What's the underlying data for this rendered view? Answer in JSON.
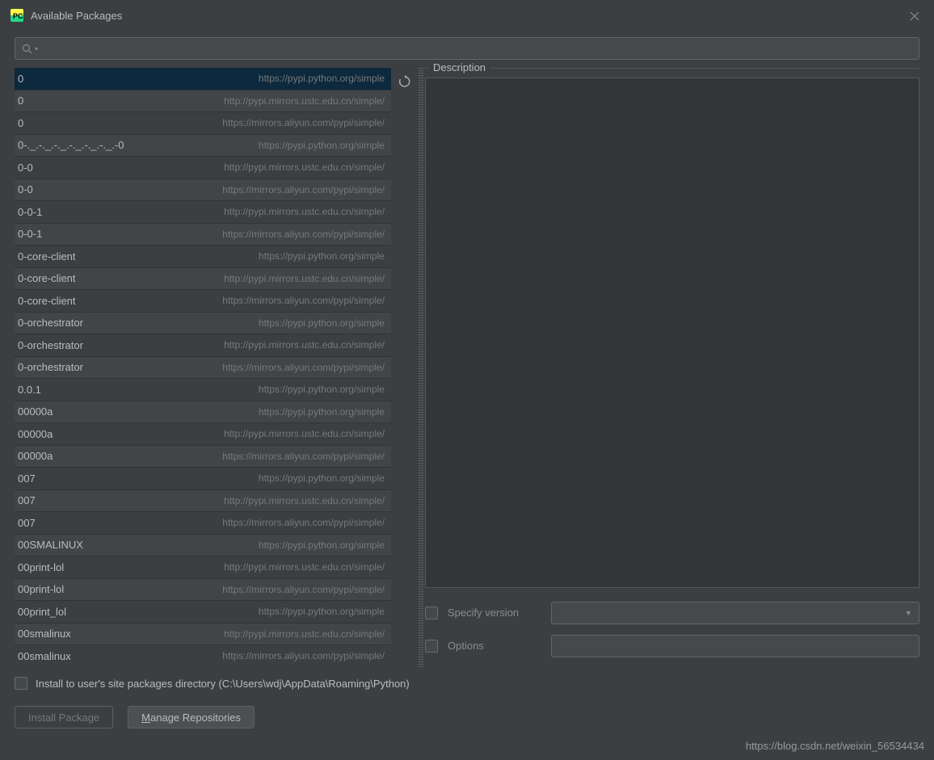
{
  "window": {
    "title": "Available Packages"
  },
  "packages": [
    {
      "name": "0",
      "source": "https://pypi.python.org/simple",
      "selected": true
    },
    {
      "name": "0",
      "source": "http://pypi.mirrors.ustc.edu.cn/simple/"
    },
    {
      "name": "0",
      "source": "https://mirrors.aliyun.com/pypi/simple/"
    },
    {
      "name": "0-._.-._.-._.-._.-._.-._.-0",
      "source": "https://pypi.python.org/simple"
    },
    {
      "name": "0-0",
      "source": "http://pypi.mirrors.ustc.edu.cn/simple/"
    },
    {
      "name": "0-0",
      "source": "https://mirrors.aliyun.com/pypi/simple/"
    },
    {
      "name": "0-0-1",
      "source": "http://pypi.mirrors.ustc.edu.cn/simple/"
    },
    {
      "name": "0-0-1",
      "source": "https://mirrors.aliyun.com/pypi/simple/"
    },
    {
      "name": "0-core-client",
      "source": "https://pypi.python.org/simple"
    },
    {
      "name": "0-core-client",
      "source": "http://pypi.mirrors.ustc.edu.cn/simple/"
    },
    {
      "name": "0-core-client",
      "source": "https://mirrors.aliyun.com/pypi/simple/"
    },
    {
      "name": "0-orchestrator",
      "source": "https://pypi.python.org/simple"
    },
    {
      "name": "0-orchestrator",
      "source": "http://pypi.mirrors.ustc.edu.cn/simple/"
    },
    {
      "name": "0-orchestrator",
      "source": "https://mirrors.aliyun.com/pypi/simple/"
    },
    {
      "name": "0.0.1",
      "source": "https://pypi.python.org/simple"
    },
    {
      "name": "00000a",
      "source": "https://pypi.python.org/simple"
    },
    {
      "name": "00000a",
      "source": "http://pypi.mirrors.ustc.edu.cn/simple/"
    },
    {
      "name": "00000a",
      "source": "https://mirrors.aliyun.com/pypi/simple/"
    },
    {
      "name": "007",
      "source": "https://pypi.python.org/simple"
    },
    {
      "name": "007",
      "source": "http://pypi.mirrors.ustc.edu.cn/simple/"
    },
    {
      "name": "007",
      "source": "https://mirrors.aliyun.com/pypi/simple/"
    },
    {
      "name": "00SMALINUX",
      "source": "https://pypi.python.org/simple"
    },
    {
      "name": "00print-lol",
      "source": "http://pypi.mirrors.ustc.edu.cn/simple/"
    },
    {
      "name": "00print-lol",
      "source": "https://mirrors.aliyun.com/pypi/simple/"
    },
    {
      "name": "00print_lol",
      "source": "https://pypi.python.org/simple"
    },
    {
      "name": "00smalinux",
      "source": "http://pypi.mirrors.ustc.edu.cn/simple/"
    },
    {
      "name": "00smalinux",
      "source": "https://mirrors.aliyun.com/pypi/simple/"
    }
  ],
  "description": {
    "label": "Description"
  },
  "specify_version": {
    "label": "Specify version",
    "value": ""
  },
  "options": {
    "label": "Options",
    "value": ""
  },
  "install_to_user": {
    "label": "Install to user's site packages directory (C:\\Users\\wdj\\AppData\\Roaming\\Python)"
  },
  "buttons": {
    "install": "Install Package",
    "manage": "Manage Repositories"
  },
  "watermark": "https://blog.csdn.net/weixin_56534434"
}
